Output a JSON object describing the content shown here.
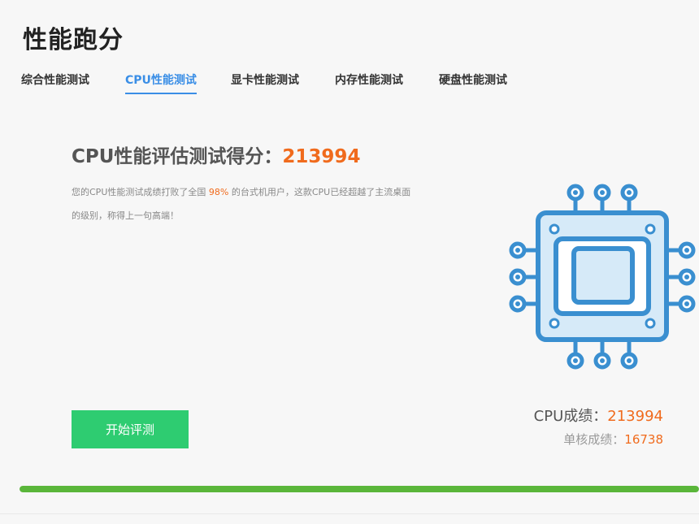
{
  "page": {
    "title": "性能跑分"
  },
  "tabs": [
    {
      "label": "综合性能测试",
      "active": false
    },
    {
      "label": "CPU性能测试",
      "active": true
    },
    {
      "label": "显卡性能测试",
      "active": false
    },
    {
      "label": "内存性能测试",
      "active": false
    },
    {
      "label": "硬盘性能测试",
      "active": false
    }
  ],
  "score": {
    "label": "CPU性能评估测试得分：",
    "value": "213994",
    "desc_prefix": "您的CPU性能测试成绩打败了全国",
    "desc_percent": "98%",
    "desc_suffix": "的台式机用户，这款CPU已经超越了主流桌面的级别，称得上一句高端！"
  },
  "actions": {
    "start_label": "开始评测"
  },
  "results": {
    "cpu_label": "CPU成绩：",
    "cpu_value": "213994",
    "single_label": "单核成绩：",
    "single_value": "16738"
  },
  "progress": {
    "percent": 100
  },
  "colors": {
    "accent_blue": "#3a8ee6",
    "score_orange": "#f06b1d",
    "button_green": "#2ecc71",
    "progress_green": "#5ab63a",
    "chip_stroke": "#3a8fd0",
    "chip_fill": "#d6eaf8"
  },
  "icons": {
    "chip": "cpu-chip-icon"
  }
}
